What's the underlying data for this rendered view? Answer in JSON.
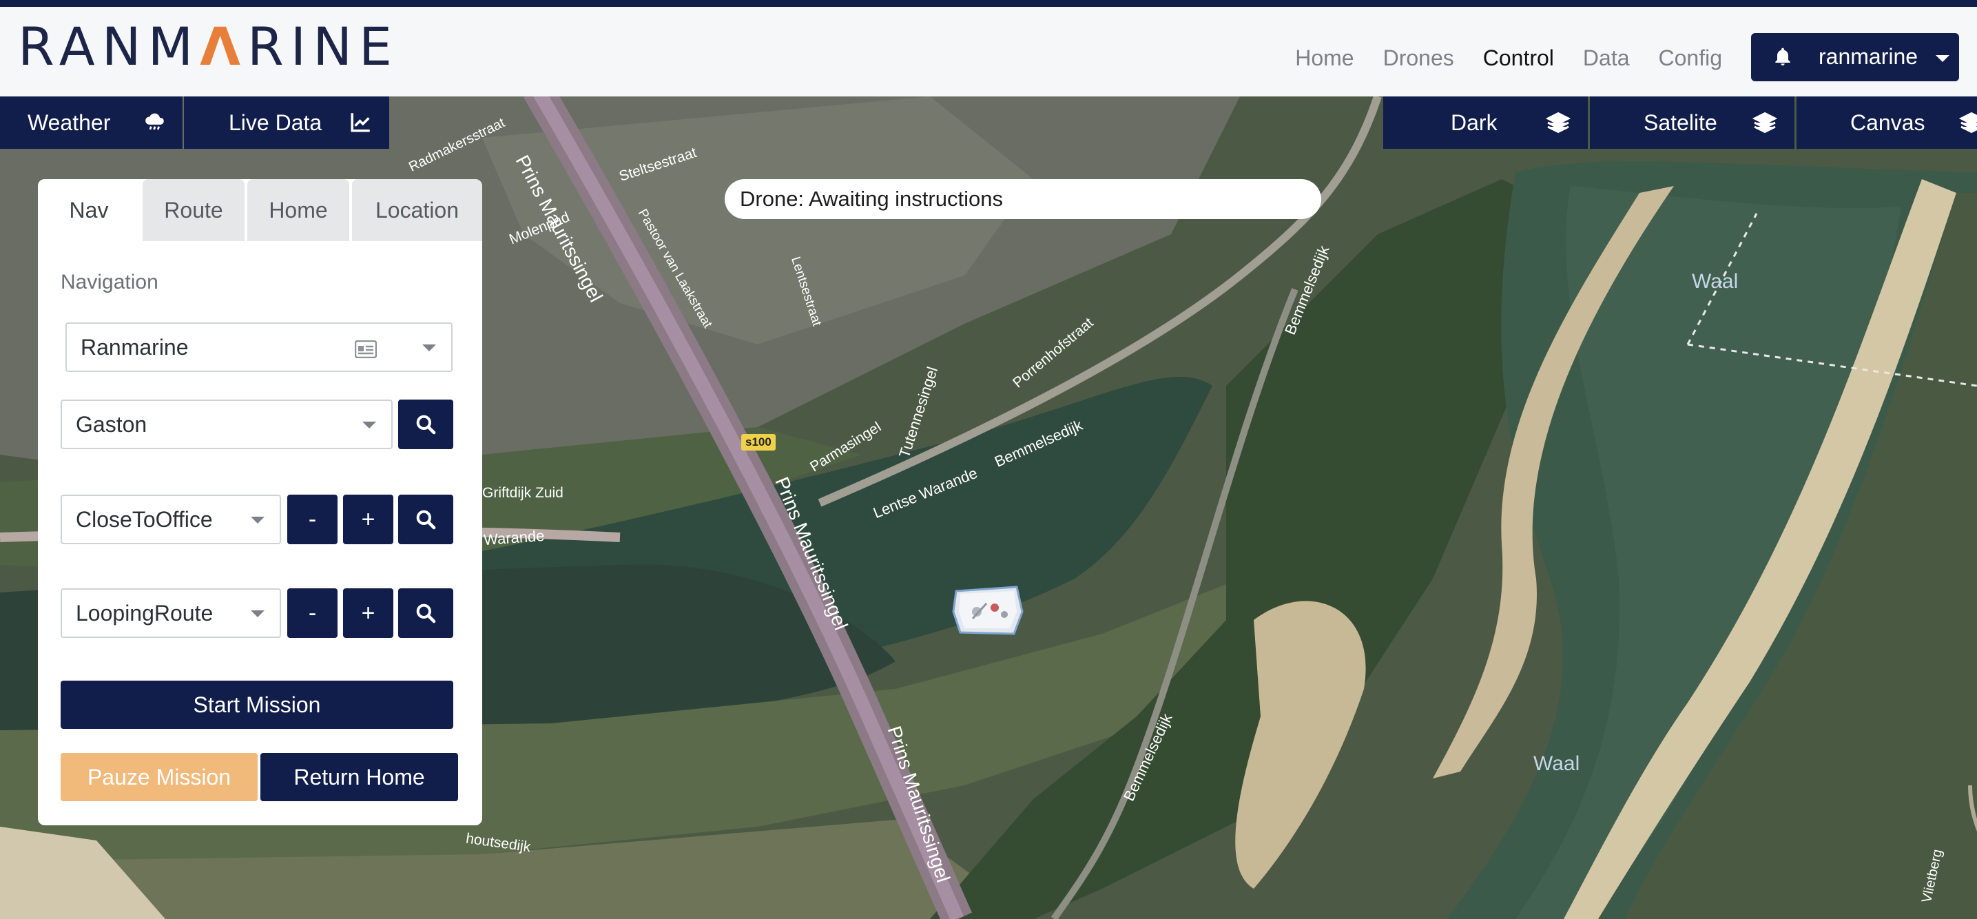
{
  "header": {
    "logo_text_a": "RANM",
    "logo_text_accent": "Λ",
    "logo_text_b": "RINE",
    "nav": [
      "Home",
      "Drones",
      "Control",
      "Data",
      "Config"
    ],
    "active_nav": "Control",
    "user_name": "ranmarine"
  },
  "map_controls": {
    "weather": "Weather",
    "live_data": "Live Data",
    "dark": "Dark",
    "satelite": "Satelite",
    "canvas": "Canvas"
  },
  "status": {
    "text": "Drone: Awaiting instructions"
  },
  "panel": {
    "tabs": [
      "Nav",
      "Route",
      "Home",
      "Location"
    ],
    "active_tab": "Nav",
    "section_label": "Navigation",
    "site_select": "Ranmarine",
    "drone_select": "Gaston",
    "location_select": "CloseToOffice",
    "route_select": "LoopingRoute",
    "minus": "-",
    "plus": "+",
    "start_mission": "Start Mission",
    "pause_mission": "Pauze Mission",
    "return_home": "Return Home"
  },
  "map_labels": {
    "prins_mauritssingel_1": "Prins Mauritssingel",
    "prins_mauritssingel_2": "Prins Mauritssingel",
    "prins_mauritssingel_3": "Prins Mauritssingel",
    "bemmelsedijk_1": "Bemmelsedijk",
    "bemmelsedijk_2": "Bemmelsedijk",
    "bemmelsedijk_3": "Bemmelsedijk",
    "waal_1": "Waal",
    "waal_2": "Waal",
    "warande": "Warande",
    "lentse_warande": "Lentse Warande",
    "s100": "s100",
    "parmasingel": "Parmasingel",
    "tuttennessingel": "Tutennesingel",
    "porrenhofstraat": "Porrenhofstraat",
    "steltsestraat": "Steltsestraat",
    "radmakersstraat": "Radmakersstraat",
    "molenpad": "Molenpad",
    "pastoor": "Pastoor van Laakstraat",
    "lentsestraat": "Lentsestraat",
    "griftdijk": "Griftdijk Zuid",
    "houtsedijk": "houtsedijk",
    "vlietberg": "Vlietberg"
  },
  "colors": {
    "brand_navy": "#111d4a",
    "accent_orange": "#e77e3a",
    "pause_orange": "#f1b97a"
  }
}
